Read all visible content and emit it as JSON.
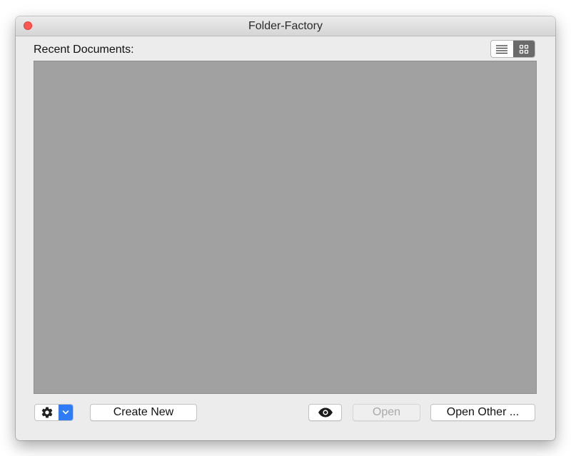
{
  "window": {
    "title": "Folder-Factory"
  },
  "main": {
    "section_label": "Recent Documents:",
    "view_toggle": {
      "options": [
        {
          "icon": "list-view-icon",
          "selected": false
        },
        {
          "icon": "grid-view-icon",
          "selected": true
        }
      ]
    }
  },
  "footer": {
    "settings_icon": "gear-icon",
    "settings_menu_icon": "chevron-down-icon",
    "create_new_label": "Create New",
    "preview_icon": "eye-icon",
    "open_label": "Open",
    "open_other_label": "Open Other ..."
  },
  "colors": {
    "close_button": "#fc5753",
    "accent": "#2f7cf6",
    "list_background": "#a1a1a1",
    "window_background": "#ececec"
  }
}
